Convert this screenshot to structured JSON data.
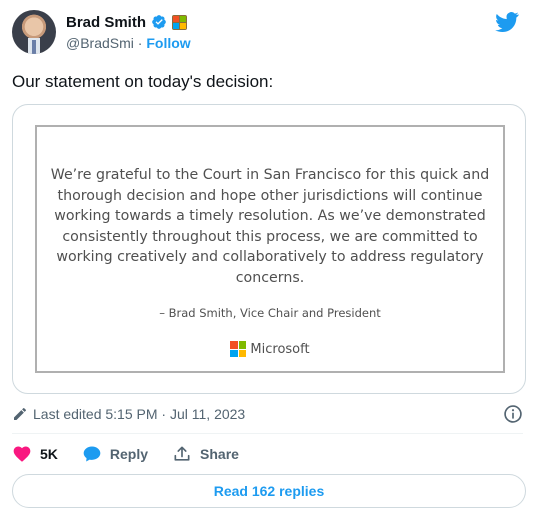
{
  "author": {
    "display_name": "Brad Smith",
    "handle": "@BradSmi",
    "separator": "·",
    "follow_label": "Follow"
  },
  "tweet": {
    "text": "Our statement on today's decision:"
  },
  "statement": {
    "body": "We’re grateful to the Court in San Francisco for this quick and thorough decision and hope other jurisdictions will continue working towards a timely resolution. As we’ve demonstrated consistently throughout this process, we are committed to working creatively and collaboratively to address regulatory concerns.",
    "attribution": "– Brad Smith, Vice Chair and President",
    "logo_text": "Microsoft"
  },
  "meta": {
    "edited": "Last edited 5:15 PM · Jul 11, 2023"
  },
  "actions": {
    "like_count": "5K",
    "reply_label": "Reply",
    "share_label": "Share"
  },
  "replies_button": "Read 162 replies",
  "colors": {
    "accent": "#1d9bf0",
    "like": "#f91880",
    "muted": "#536471",
    "ms_red": "#f25022",
    "ms_green": "#7fba00",
    "ms_blue": "#00a4ef",
    "ms_yellow": "#ffb900"
  },
  "icons": [
    "verified-badge-icon",
    "microsoft-badge-icon",
    "twitter-bird-icon",
    "pencil-icon",
    "info-icon",
    "heart-icon",
    "reply-bubble-icon",
    "share-icon",
    "microsoft-logo-icon"
  ]
}
